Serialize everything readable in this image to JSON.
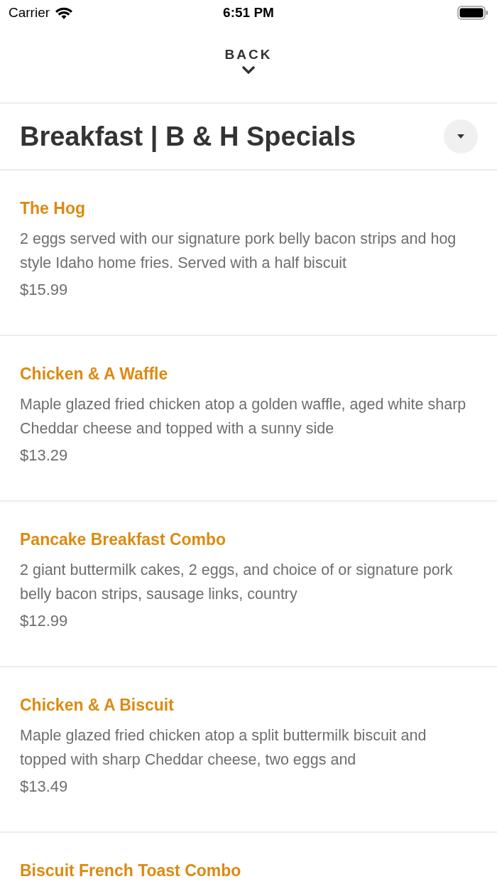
{
  "status_bar": {
    "carrier": "Carrier",
    "time": "6:51 PM"
  },
  "back": {
    "label": "BACK"
  },
  "category": {
    "title": "Breakfast | B & H Specials",
    "expanded": false
  },
  "items": [
    {
      "name": "The Hog",
      "description": "2 eggs served with our signature pork belly bacon strips and hog style Idaho home fries. Served with a half biscuit",
      "price": "$15.99"
    },
    {
      "name": "Chicken & A Waffle",
      "description": "Maple glazed fried chicken atop a golden waffle, aged white sharp Cheddar cheese and topped with a sunny side",
      "price": "$13.29"
    },
    {
      "name": "Pancake Breakfast Combo",
      "description": "2 giant buttermilk cakes, 2 eggs, and choice of or signature pork belly bacon strips, sausage links, country",
      "price": "$12.99"
    },
    {
      "name": "Chicken & A Biscuit",
      "description": "Maple glazed fried chicken atop a split buttermilk biscuit and topped with sharp Cheddar cheese, two eggs and",
      "price": "$13.49"
    },
    {
      "name": "Biscuit French Toast Combo"
    }
  ]
}
